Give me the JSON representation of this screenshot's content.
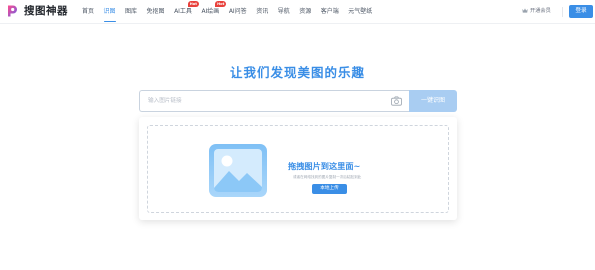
{
  "brand": {
    "name": "搜图神器"
  },
  "nav": {
    "items": [
      {
        "label": "首页",
        "active": false,
        "badge": ""
      },
      {
        "label": "识图",
        "active": true,
        "badge": ""
      },
      {
        "label": "图库",
        "active": false,
        "badge": ""
      },
      {
        "label": "免抠图",
        "active": false,
        "badge": ""
      },
      {
        "label": "AI工具",
        "active": false,
        "badge": "Hot"
      },
      {
        "label": "AI绘画",
        "active": false,
        "badge": "Hot"
      },
      {
        "label": "AI问答",
        "active": false,
        "badge": ""
      },
      {
        "label": "资讯",
        "active": false,
        "badge": ""
      },
      {
        "label": "导航",
        "active": false,
        "badge": ""
      },
      {
        "label": "资源",
        "active": false,
        "badge": ""
      },
      {
        "label": "客户端",
        "active": false,
        "badge": ""
      },
      {
        "label": "元气壁纸",
        "active": false,
        "badge": ""
      }
    ]
  },
  "header_right": {
    "vip_label": "开通会员",
    "login_label": "登录"
  },
  "hero": {
    "title": "让我们发现美图的乐趣",
    "search_placeholder": "输入图片链接",
    "search_button": "一键识图"
  },
  "upload": {
    "title": "拖拽图片到这里面~",
    "subtitle": "或者在网络找到的图片复制一次后粘贴到此",
    "button": "本地上传"
  },
  "colors": {
    "accent": "#3a8ee6",
    "search_button": "#a9cdf2",
    "hot_badge": "#e8413b"
  }
}
